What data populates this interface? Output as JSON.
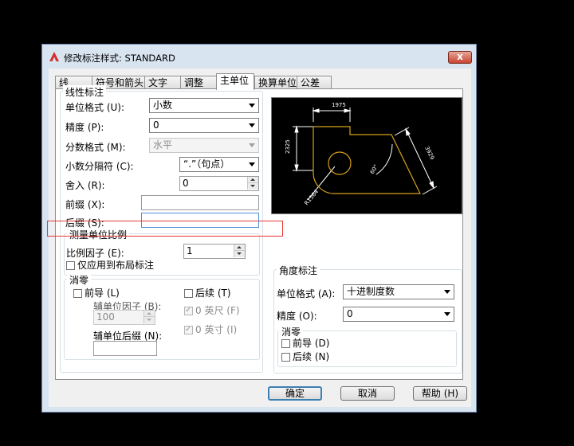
{
  "window": {
    "title": "修改标注样式: STANDARD",
    "close": "x",
    "colors": {
      "accent": "#d42e2e",
      "highlight_box": "#e53935",
      "preview_bg": "#000000",
      "preview_geometry": "#d7a21a"
    }
  },
  "tabs": [
    "线",
    "符号和箭头",
    "文字",
    "调整",
    "主单位",
    "换算单位",
    "公差"
  ],
  "active_tab": "主单位",
  "linear": {
    "group_label": "线性标注",
    "unit_format_label": "单位格式 (U):",
    "unit_format_value": "小数",
    "precision_label": "精度 (P):",
    "precision_value": "0",
    "fraction_format_label": "分数格式 (M):",
    "fraction_format_value": "水平",
    "decimal_separator_label": "小数分隔符 (C):",
    "decimal_separator_value": "“.”（句点）",
    "round_off_label": "舍入 (R):",
    "round_off_value": "0",
    "prefix_label": "前缀 (X):",
    "prefix_value": "",
    "suffix_label": "后缀 (S):",
    "suffix_value": ""
  },
  "scale": {
    "group_label": "测量单位比例",
    "factor_label": "比例因子 (E):",
    "factor_value": "1",
    "layout_only_label": "仅应用到布局标注"
  },
  "zero_suppression": {
    "group_label": "消零",
    "leading_label": "前导 (L)",
    "trailing_label": "后续 (T)",
    "sub_unit_factor_label": "辅单位因子 (B):",
    "sub_unit_factor_value": "100",
    "sub_unit_suffix_label": "辅单位后缀 (N):",
    "sub_unit_suffix_value": "",
    "feet_label": "0 英尺 (F)",
    "inches_label": "0 英寸 (I)"
  },
  "angular": {
    "group_label": "角度标注",
    "unit_format_label": "单位格式 (A):",
    "unit_format_value": "十进制度数",
    "precision_label": "精度 (O):",
    "precision_value": "0",
    "zero_group_label": "消零",
    "leading_label": "前导 (D)",
    "trailing_label": "后续 (N)"
  },
  "preview": {
    "dim_top": "1975",
    "dim_left": "2325",
    "dim_diag": "3929",
    "angle": "60°",
    "radius": "R1564"
  },
  "buttons": {
    "ok": "确定",
    "cancel": "取消",
    "help": "帮助 (H)"
  }
}
